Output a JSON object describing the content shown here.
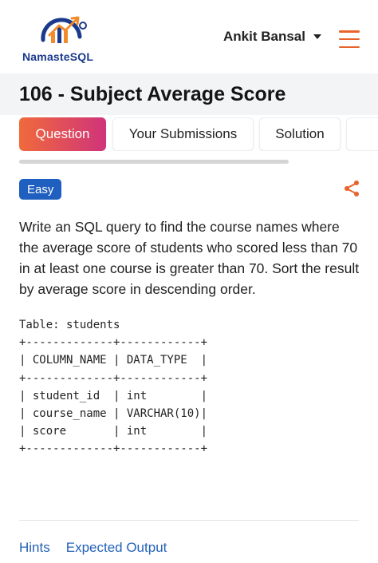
{
  "header": {
    "logo_text": "NamasteSQL",
    "user_name": "Ankit Bansal",
    "accent_color": "#e8632b"
  },
  "problem": {
    "title": "106 - Subject Average Score",
    "difficulty": "Easy",
    "description": "Write an SQL query to find the course names where the average score of students who scored less than 70 in at least one course is greater than 70. Sort the result by average score in descending order."
  },
  "tabs": [
    {
      "label": "Question",
      "active": true
    },
    {
      "label": "Your Submissions",
      "active": false
    },
    {
      "label": "Solution",
      "active": false
    }
  ],
  "schema": {
    "table_label": "Table: students",
    "border": "+-------------+------------+",
    "header_row": "| COLUMN_NAME | DATA_TYPE  |",
    "rows": [
      "| student_id  | int        |",
      "| course_name | VARCHAR(10)|",
      "| score       | int        |"
    ]
  },
  "bottom_tabs": {
    "hints": "Hints",
    "expected_output": "Expected Output"
  },
  "icons": [
    "chart-growth-logo-icon",
    "chevron-down-icon",
    "hamburger-menu-icon",
    "share-icon"
  ]
}
